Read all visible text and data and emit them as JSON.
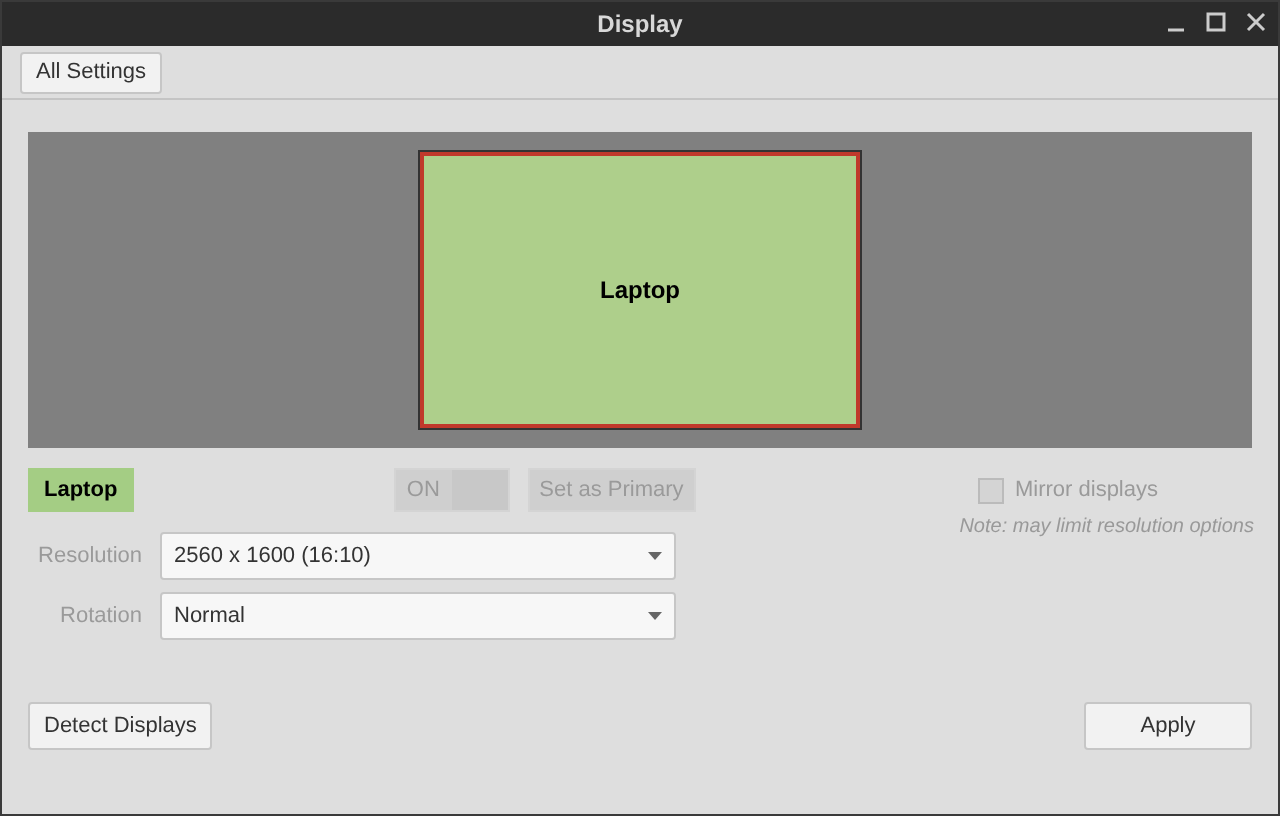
{
  "window": {
    "title": "Display"
  },
  "toolbar": {
    "all_settings": "All Settings"
  },
  "arrangement": {
    "monitors": [
      {
        "label": "Laptop",
        "selected": true
      }
    ]
  },
  "output": {
    "name": "Laptop",
    "power": {
      "label": "ON",
      "on": true,
      "disabled": true
    },
    "set_primary": {
      "label": "Set as Primary",
      "disabled": true
    }
  },
  "mirror": {
    "label": "Mirror displays",
    "checked": false,
    "disabled": true,
    "note": "Note: may limit resolution options"
  },
  "settings": [
    {
      "label": "Resolution",
      "value": "2560 x 1600 (16:10)"
    },
    {
      "label": "Rotation",
      "value": "Normal"
    }
  ],
  "buttons": {
    "detect": "Detect Displays",
    "apply": "Apply"
  }
}
